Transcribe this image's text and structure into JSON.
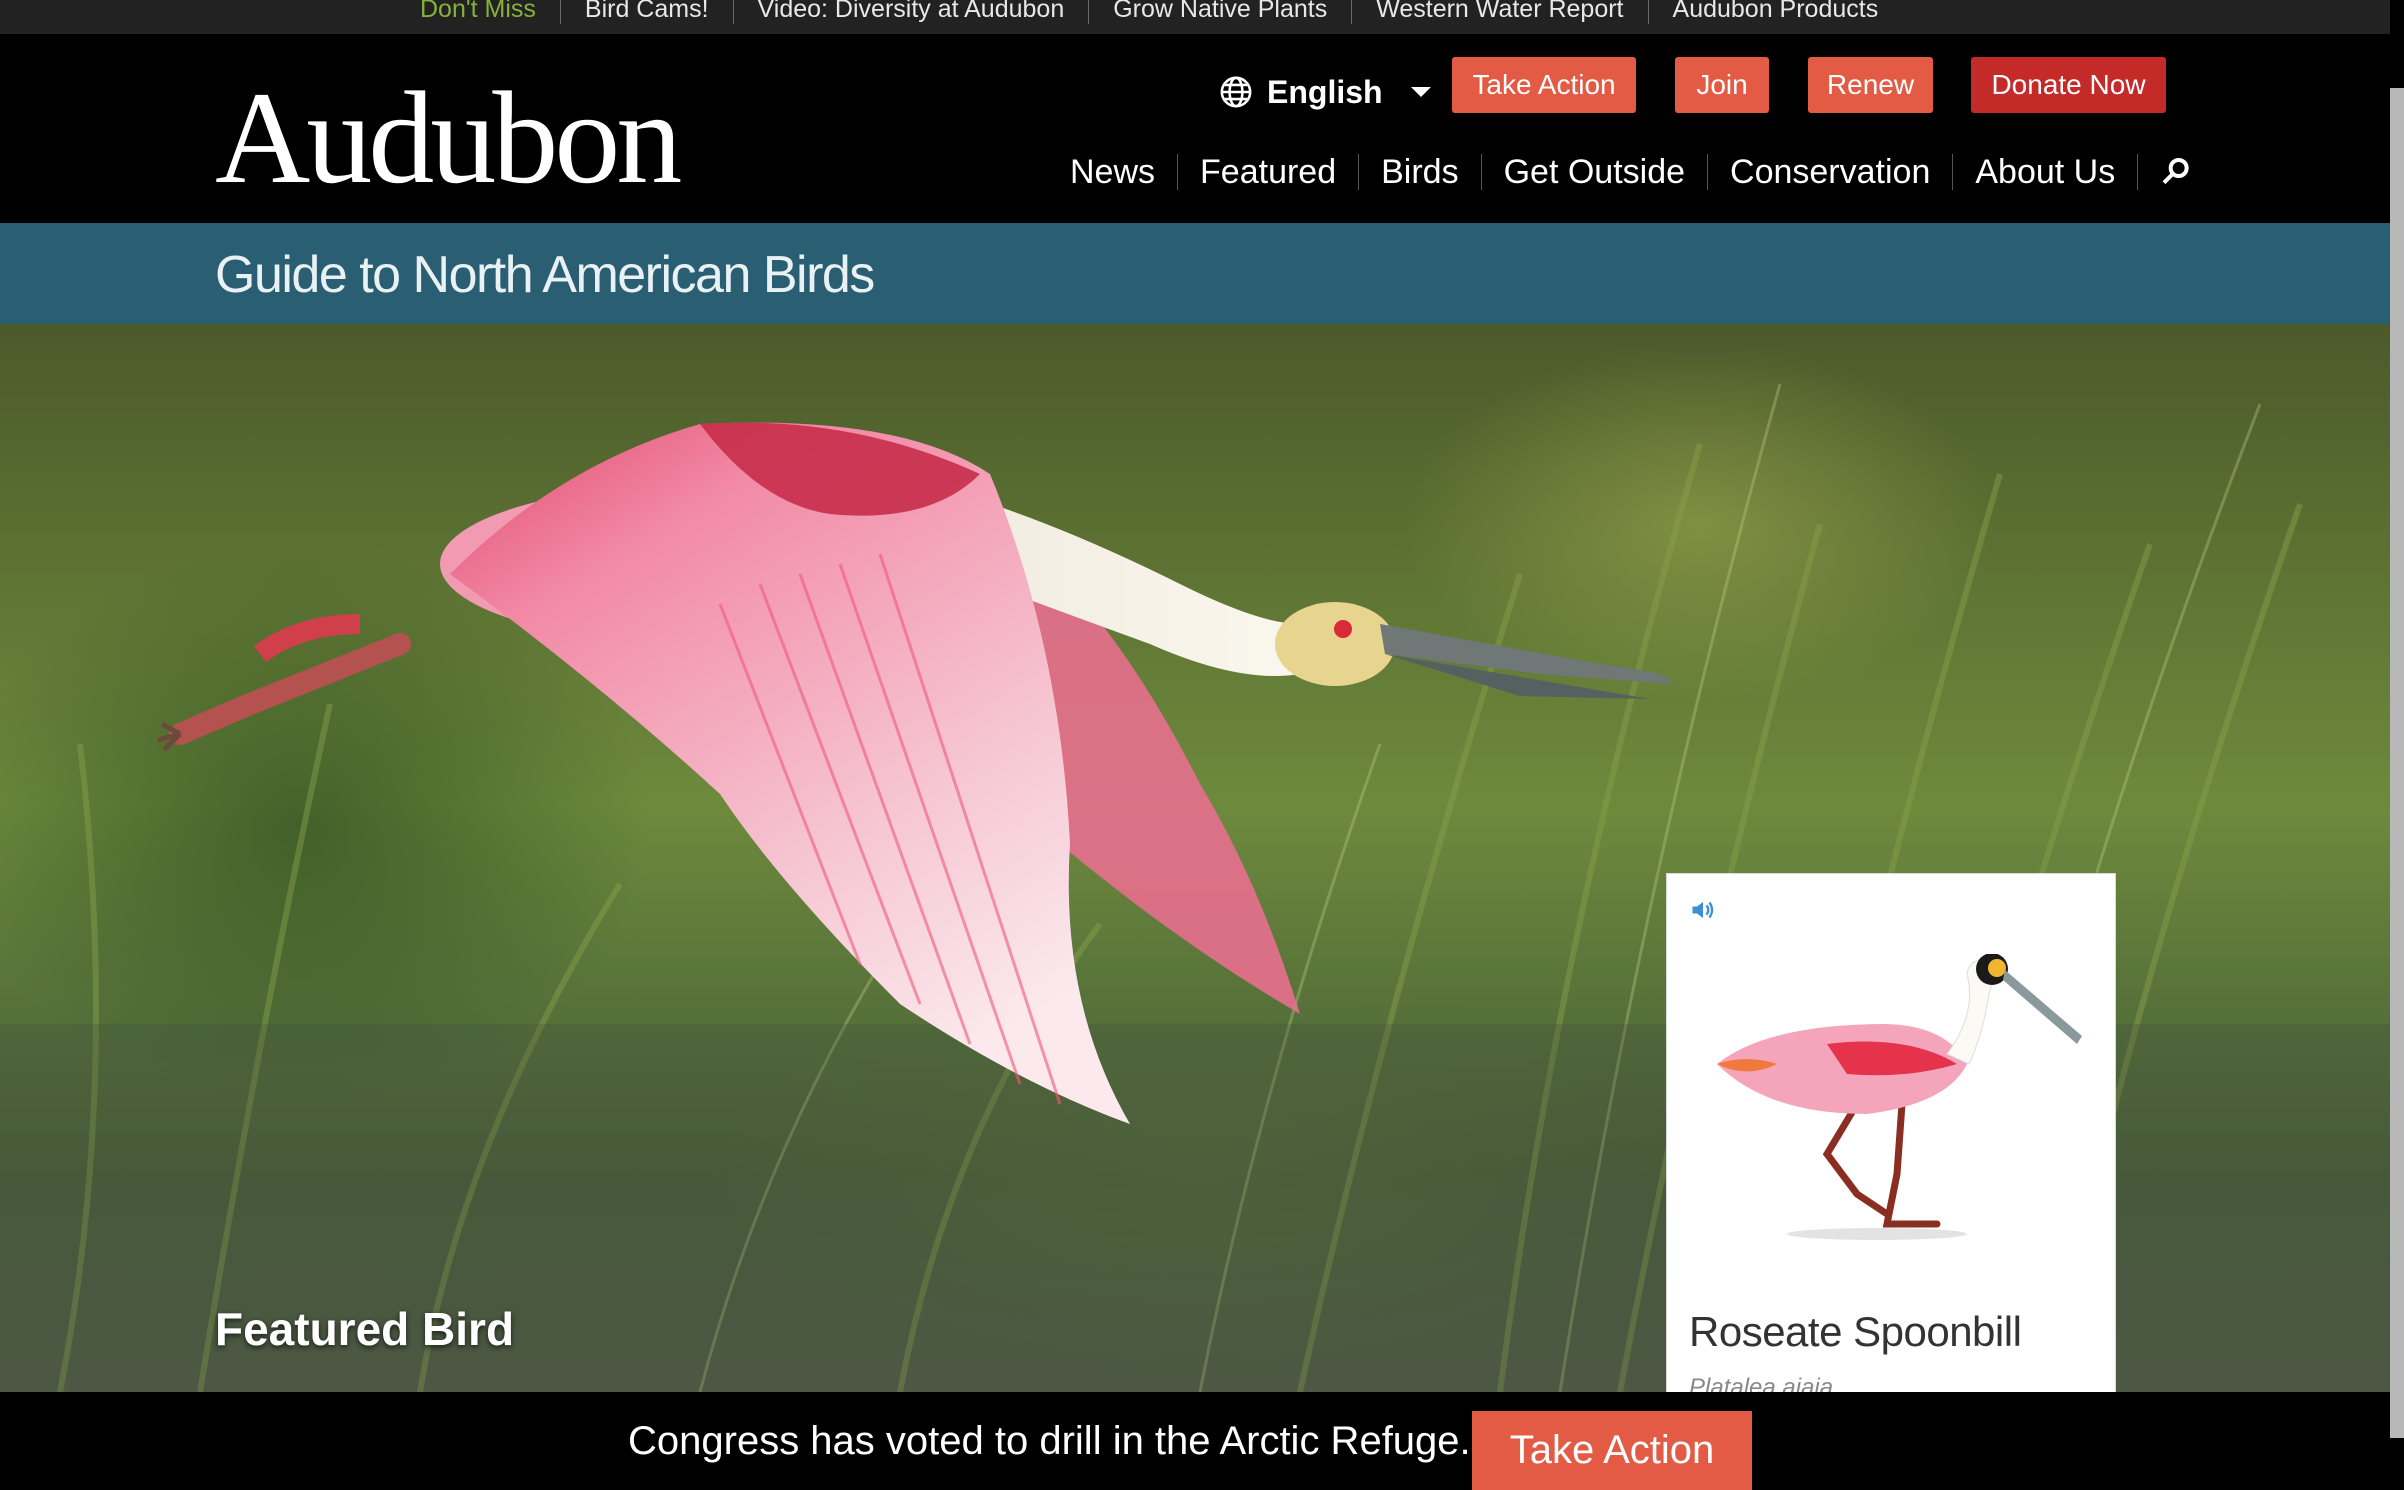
{
  "top_strip": {
    "label": "Don't Miss",
    "items": [
      "Bird Cams!",
      "Video: Diversity at Audubon",
      "Grow Native Plants",
      "Western Water Report",
      "Audubon Products"
    ]
  },
  "header": {
    "logo": "Audubon",
    "language": "English",
    "buttons": {
      "take_action": "Take Action",
      "join": "Join",
      "renew": "Renew",
      "donate": "Donate Now"
    },
    "nav": [
      "News",
      "Featured",
      "Birds",
      "Get Outside",
      "Conservation",
      "About Us"
    ]
  },
  "band": {
    "title": "Guide to North American Birds"
  },
  "hero": {
    "featured_label": "Featured Bird"
  },
  "card": {
    "name": "Roseate Spoonbill",
    "scientific": "Platalea ajaja"
  },
  "alert": {
    "message": "Congress has voted to drill in the Arctic Refuge.",
    "button": "Take Action"
  },
  "colors": {
    "accent": "#e35a45",
    "donate": "#c42a27",
    "band": "#2a5f73",
    "dont_miss": "#86b13a"
  }
}
